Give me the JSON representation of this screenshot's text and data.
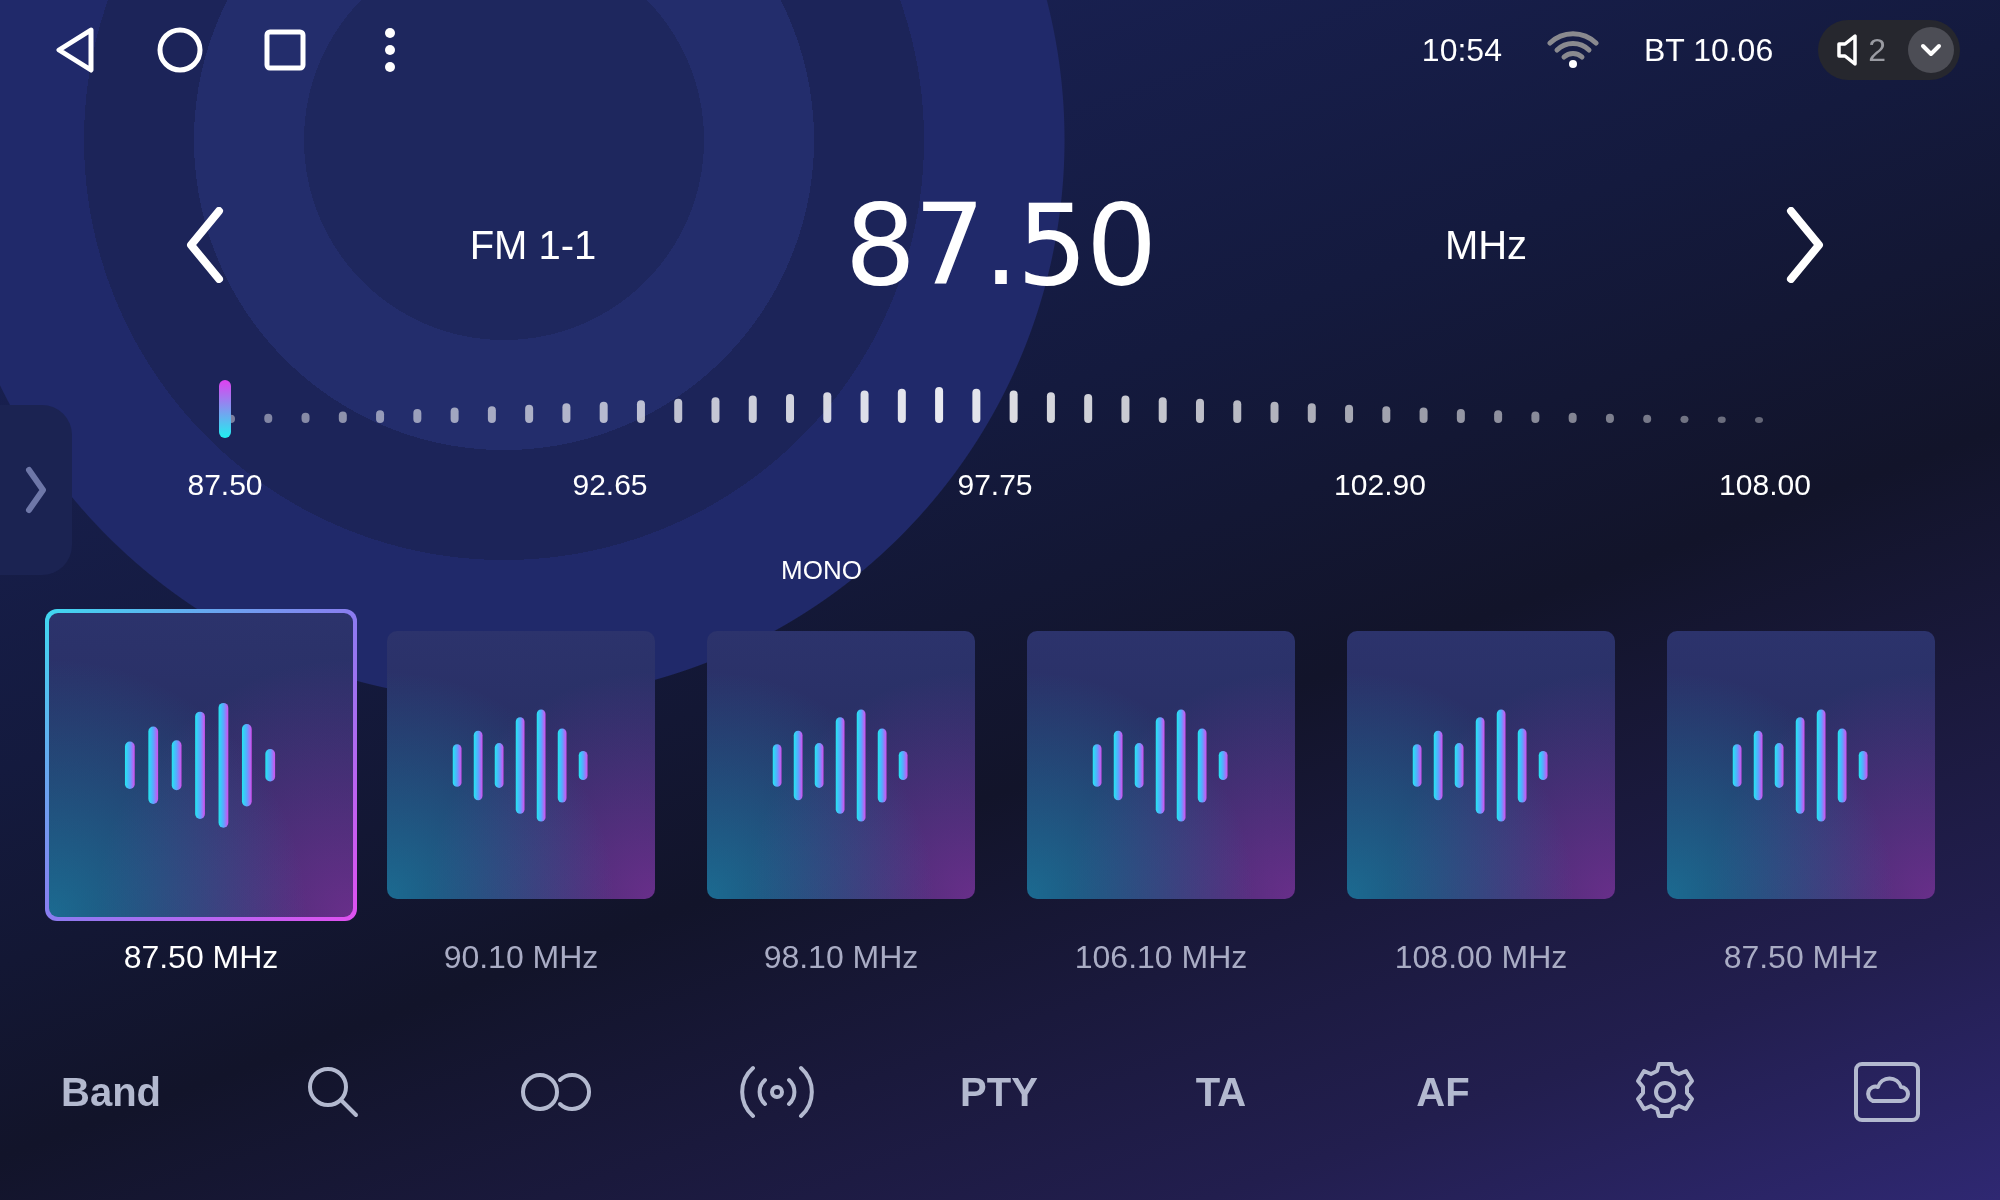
{
  "status_bar": {
    "time": "10:54",
    "bluetooth": "BT 10.06",
    "volume": "2"
  },
  "header": {
    "band": "FM 1-1",
    "frequency": "87.50",
    "unit": "MHz"
  },
  "tuner": {
    "level": 0,
    "labels": [
      "87.50",
      "92.65",
      "97.75",
      "102.90",
      "108.00"
    ]
  },
  "stereo_indicator": "MONO",
  "presets": [
    {
      "label": "87.50 MHz",
      "selected": true
    },
    {
      "label": "90.10 MHz",
      "selected": false
    },
    {
      "label": "98.10 MHz",
      "selected": false
    },
    {
      "label": "106.10 MHz",
      "selected": false
    },
    {
      "label": "108.00 MHz",
      "selected": false
    },
    {
      "label": "87.50 MHz",
      "selected": false
    }
  ],
  "toolbar": [
    {
      "kind": "text",
      "label": "Band"
    },
    {
      "kind": "search"
    },
    {
      "kind": "loop"
    },
    {
      "kind": "broadcast"
    },
    {
      "kind": "text",
      "label": "PTY"
    },
    {
      "kind": "text",
      "label": "TA"
    },
    {
      "kind": "text",
      "label": "AF"
    },
    {
      "kind": "settings"
    },
    {
      "kind": "cloud"
    }
  ]
}
